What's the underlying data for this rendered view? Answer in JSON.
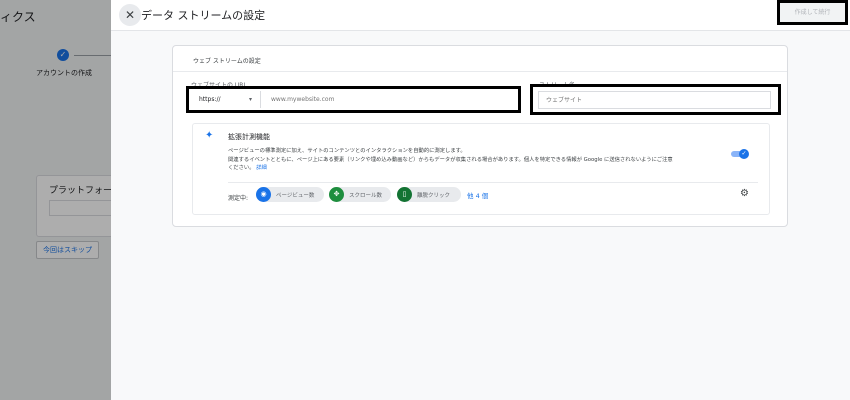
{
  "background": {
    "title": "ィクス",
    "step_label": "アカウントの作成",
    "step_check": "✓",
    "card_label": "プラットフォーム",
    "skip_button": "今回はスキップ"
  },
  "dialog": {
    "close_icon": "close-icon",
    "close_glyph": "✕",
    "title": "データ ストリームの設定",
    "create_button": "作成して続行"
  },
  "card": {
    "title": "ウェブ ストリームの設定",
    "url_label": "ウェブサイトの URL",
    "protocol": "https://",
    "protocol_chevron": "▾",
    "url_placeholder": "www.mywebsite.com",
    "name_label": "ストリーム名",
    "name_placeholder": "ウェブサイト"
  },
  "enhanced": {
    "icon": "sparkle-icon",
    "icon_glyph": "✦",
    "title": "拡張計測機能",
    "desc_line1": "ページビューの標準測定に加え、サイトのコンテンツとのインタラクションを自動的に測定します。",
    "desc_line2": "関連するイベントとともに、ページ上にある要素（リンクや埋め込み動画など）からもデータが収集される場合があります。個人を特定できる情報が Google に送信されないようにご注意",
    "desc_line3": "ください。",
    "details_link": "詳細",
    "toggle_on": true,
    "toggle_check": "✓",
    "measuring_label": "測定中:",
    "chips": [
      {
        "label": "ページビュー数",
        "icon": "eye-icon",
        "glyph": "◉",
        "color": "#1a73e8"
      },
      {
        "label": "スクロール数",
        "icon": "scroll-icon",
        "glyph": "✥",
        "color": "#1e8e3e"
      },
      {
        "label": "離脱クリック",
        "icon": "mouse-icon",
        "glyph": "▯",
        "color": "#137333"
      }
    ],
    "more_link": "他 4 個",
    "settings_icon": "gear-icon",
    "settings_glyph": "⚙"
  }
}
